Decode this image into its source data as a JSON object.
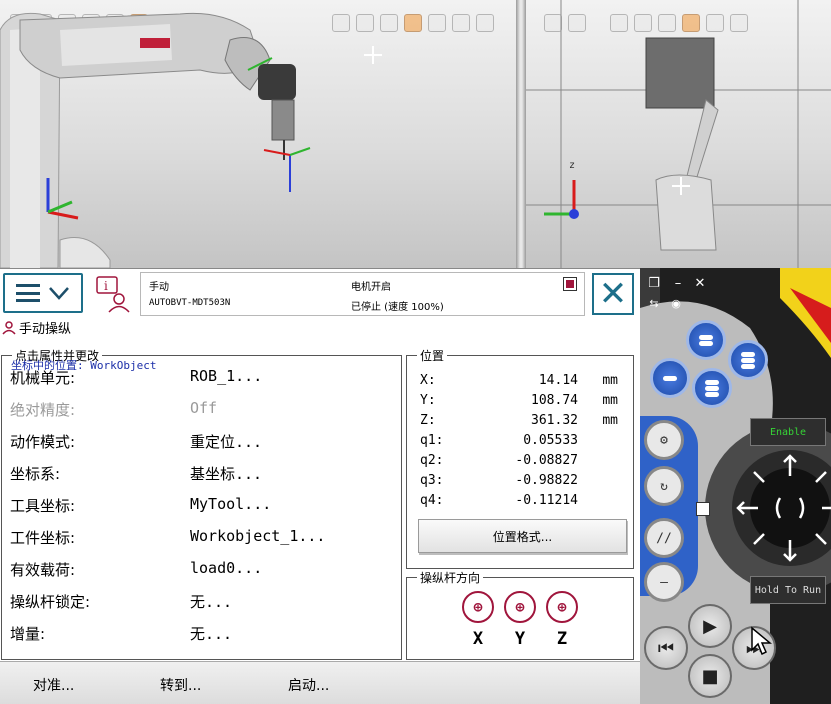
{
  "viewport_right": {
    "axis_label": "z"
  },
  "header": {
    "mode_label": "手动",
    "controller_name": "AUTOBVT-MDT503N",
    "motor_state": "电机开启",
    "program_state": "已停止 (速度 100%)"
  },
  "page": {
    "title": "手动操纵"
  },
  "props": {
    "legend": "点击属性并更改",
    "rows": [
      {
        "key": "机械单元:",
        "value": "ROB_1..."
      },
      {
        "key": "绝对精度:",
        "value": "Off"
      },
      {
        "key": "动作模式:",
        "value": "重定位..."
      },
      {
        "key": "坐标系:",
        "value": "基坐标..."
      },
      {
        "key": "工具坐标:",
        "value": "MyTool..."
      },
      {
        "key": "工件坐标:",
        "value": "Workobject_1..."
      },
      {
        "key": "有效载荷:",
        "value": "load0..."
      },
      {
        "key": "操纵杆锁定:",
        "value": "无..."
      },
      {
        "key": "增量:",
        "value": "无..."
      }
    ]
  },
  "position": {
    "legend": "位置",
    "frame_label": "坐标中的位置: WorkObject",
    "rows": [
      {
        "key": "X:",
        "value": "14.14",
        "unit": "mm"
      },
      {
        "key": "Y:",
        "value": "108.74",
        "unit": "mm"
      },
      {
        "key": "Z:",
        "value": "361.32",
        "unit": "mm"
      },
      {
        "key": "q1:",
        "value": "0.05533",
        "unit": ""
      },
      {
        "key": "q2:",
        "value": "-0.08827",
        "unit": ""
      },
      {
        "key": "q3:",
        "value": "-0.98822",
        "unit": ""
      },
      {
        "key": "q4:",
        "value": "-0.11214",
        "unit": ""
      }
    ],
    "format_button": "位置格式..."
  },
  "joystick": {
    "legend": "操纵杆方向",
    "axes": [
      "X",
      "Y",
      "Z"
    ]
  },
  "bottom": {
    "align": "对准...",
    "goto": "转到...",
    "activate": "启动..."
  },
  "hardware": {
    "enable_label": "Enable",
    "hold_label": "Hold To Run"
  },
  "colors": {
    "accent": "#1d6f8a",
    "joystick_icon": "#a0153c",
    "position_frame": "#1c2fa8",
    "hw_button": "#2f62c8"
  }
}
